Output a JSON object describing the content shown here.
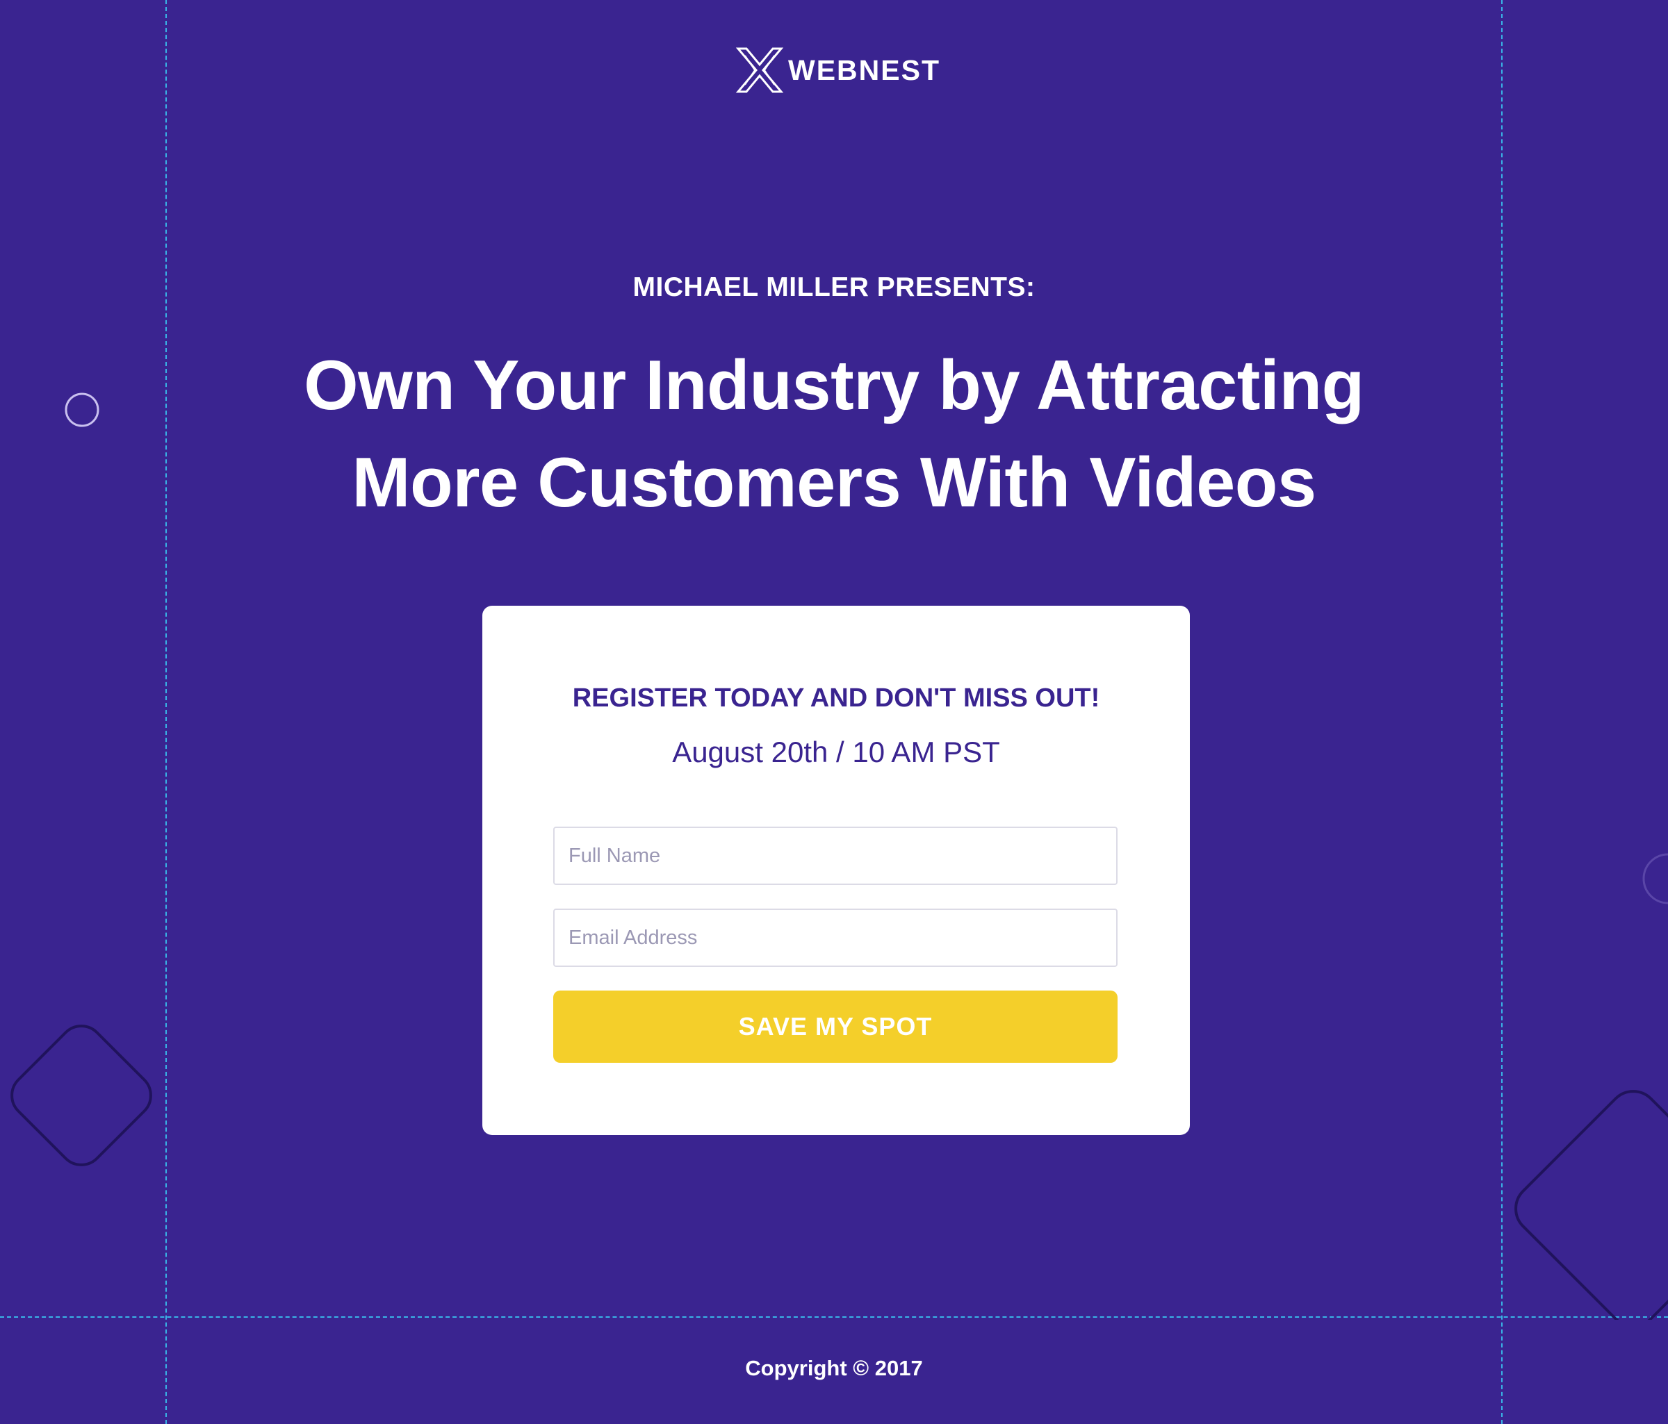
{
  "brand": {
    "name": "WEBNEST",
    "logo_icon": "webnest-x-logo-icon"
  },
  "hero": {
    "presenter": "MICHAEL MILLER PRESENTS:",
    "headline_line1": "Own Your Industry by Attracting",
    "headline_line2": "More Customers With Videos"
  },
  "form": {
    "heading": "REGISTER TODAY AND DON'T MISS OUT!",
    "date": "August 20th / 10 AM PST",
    "name_placeholder": "Full Name",
    "email_placeholder": "Email Address",
    "submit_label": "SAVE MY SPOT"
  },
  "footer": {
    "copyright": "Copyright © 2017"
  },
  "colors": {
    "background": "#3a2490",
    "accent": "#f4cf2a",
    "card": "#ffffff",
    "guides": "#39b4e6"
  }
}
